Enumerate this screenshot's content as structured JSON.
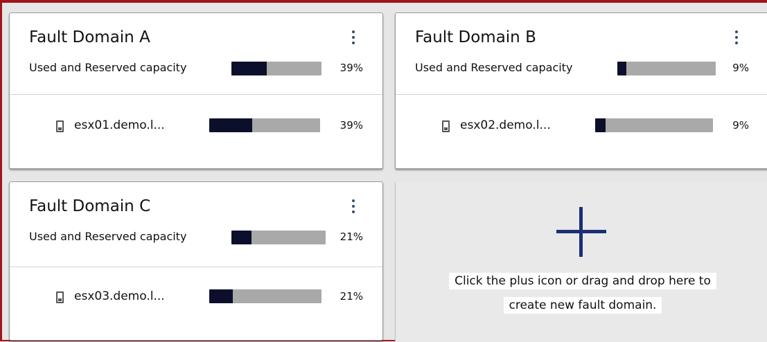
{
  "fault_domains": [
    {
      "name": "Fault Domain A",
      "capacity_label": "Used and Reserved capacity",
      "capacity_percent": "39%",
      "capacity_fraction": 0.39,
      "hosts": [
        {
          "name": "esx01.demo.l...",
          "percent": "39%",
          "fraction": 0.39
        }
      ]
    },
    {
      "name": "Fault Domain B",
      "capacity_label": "Used and Reserved capacity",
      "capacity_percent": "9%",
      "capacity_fraction": 0.09,
      "hosts": [
        {
          "name": "esx02.demo.l...",
          "percent": "9%",
          "fraction": 0.09
        }
      ]
    },
    {
      "name": "Fault Domain C",
      "capacity_label": "Used and Reserved capacity",
      "capacity_percent": "21%",
      "capacity_fraction": 0.21,
      "hosts": [
        {
          "name": "esx03.demo.l...",
          "percent": "21%",
          "fraction": 0.21
        }
      ]
    }
  ],
  "add_domain": {
    "line1": "Click the plus icon or drag and drop here to",
    "line2": "create new fault domain."
  },
  "colors": {
    "bar_fill": "#0c0f2c",
    "bar_track": "#a9a9a9",
    "kebab": "#2f4d72",
    "plus": "#1b2f75",
    "frame_border": "#a0161b"
  },
  "icons": {
    "menu": "kebab-menu-icon",
    "host": "server-host-icon",
    "add": "plus-icon"
  }
}
